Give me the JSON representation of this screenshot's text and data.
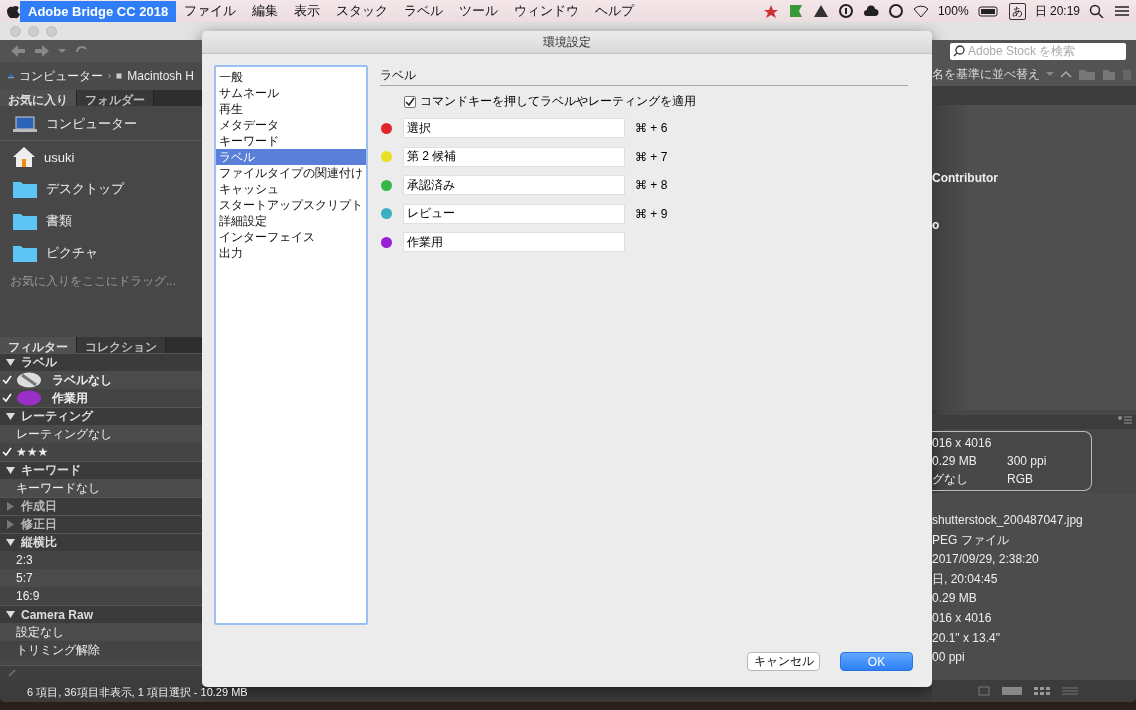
{
  "menu_bar": {
    "app_name": "Adobe Bridge CC 2018",
    "app_highlighted": true,
    "menus": [
      "ファイル",
      "編集",
      "表示",
      "スタック",
      "ラベル",
      "ツール",
      "ウィンドウ",
      "ヘルプ"
    ],
    "battery": "100%",
    "input_mode": "あ",
    "clock": "日 20:19"
  },
  "path_bar": {
    "items": [
      {
        "kind": "computer",
        "label": "コンピューター"
      },
      {
        "kind": "disk",
        "label": "Macintosh H"
      }
    ]
  },
  "panel_tabs": [
    {
      "label": "お気に入り",
      "selected": true
    },
    {
      "label": "フォルダー",
      "selected": false
    }
  ],
  "favorites": {
    "items": [
      {
        "kind": "computer",
        "label": "コンピューター"
      },
      {
        "kind": "home",
        "label": "usuki"
      },
      {
        "kind": "folder",
        "label": "デスクトップ"
      },
      {
        "kind": "folder",
        "label": "書類"
      },
      {
        "kind": "folder",
        "label": "ピクチャ"
      }
    ],
    "hint": "お気に入りをここにドラッグ..."
  },
  "filter_tabs": [
    {
      "label": "フィルター",
      "selected": true
    },
    {
      "label": "コレクション",
      "selected": false
    }
  ],
  "filters": [
    {
      "label": "ラベル",
      "expanded": true,
      "children": [
        {
          "label": "ラベルなし",
          "checked": true,
          "kind": "none"
        },
        {
          "label": "作業用",
          "checked": true,
          "kind": "swatch",
          "color": "#9a2fc8"
        }
      ]
    },
    {
      "label": "レーティング",
      "expanded": true,
      "children": [
        {
          "label": "レーティングなし",
          "checked": false,
          "kind": "text"
        },
        {
          "label": "★★★",
          "checked": true,
          "kind": "text"
        }
      ]
    },
    {
      "label": "キーワード",
      "expanded": true,
      "children": [
        {
          "label": "キーワードなし",
          "checked": false,
          "kind": "text"
        }
      ]
    },
    {
      "label": "作成日",
      "expanded": false
    },
    {
      "label": "修正日",
      "expanded": false
    },
    {
      "label": "縦横比",
      "expanded": true,
      "children": [
        {
          "label": "2:3",
          "checked": false,
          "kind": "text"
        },
        {
          "label": "5:7",
          "checked": false,
          "kind": "text"
        },
        {
          "label": "16:9",
          "checked": false,
          "kind": "text"
        }
      ]
    },
    {
      "label": "Camera Raw",
      "expanded": true,
      "children": [
        {
          "label": "設定なし",
          "checked": false,
          "kind": "text"
        },
        {
          "label": "トリミング解除",
          "checked": false,
          "kind": "text"
        }
      ]
    }
  ],
  "status_bar": "6 項目, 36項目非表示, 1 項目選択 - 10.29 MB",
  "search": {
    "placeholder": "Adobe Stock を検索"
  },
  "sort": {
    "label": "名を基準に並べ替え"
  },
  "content_texts": [
    "Contributor",
    "o"
  ],
  "metadata_summary": [
    [
      "016 x 4016"
    ],
    [
      "0.29 MB",
      "300 ppi"
    ],
    [
      "グなし",
      "RGB"
    ]
  ],
  "metadata_values": [
    "shutterstock_200487047.jpg",
    "PEG ファイル",
    "2017/09/29, 2:38:20",
    "日, 20:04:45",
    "0.29 MB",
    "016 x 4016",
    "20.1\" x 13.4\"",
    "00 ppi"
  ],
  "dialog": {
    "title": "環境設定",
    "categories": [
      {
        "label": "一般",
        "selected": false
      },
      {
        "label": "サムネール",
        "selected": false
      },
      {
        "label": "再生",
        "selected": false
      },
      {
        "label": "メタデータ",
        "selected": false
      },
      {
        "label": "キーワード",
        "selected": false
      },
      {
        "label": "ラベル",
        "selected": true
      },
      {
        "label": "ファイルタイプの関連付け",
        "selected": false
      },
      {
        "label": "キャッシュ",
        "selected": false
      },
      {
        "label": "スタートアップスクリプト",
        "selected": false
      },
      {
        "label": "詳細設定",
        "selected": false
      },
      {
        "label": "インターフェイス",
        "selected": false
      },
      {
        "label": "出力",
        "selected": false
      }
    ],
    "section_title": "ラベル",
    "option": {
      "label": "コマンドキーを押してラベルやレーティングを適用",
      "checked": true
    },
    "labels": [
      {
        "color": "#e0262a",
        "name": "選択",
        "shortcut": "⌘ + 6"
      },
      {
        "color": "#e8e021",
        "name": "第 2 候補",
        "shortcut": "⌘ + 7"
      },
      {
        "color": "#35b84a",
        "name": "承認済み",
        "shortcut": "⌘ + 8"
      },
      {
        "color": "#3aafc0",
        "name": "レビュー",
        "shortcut": "⌘ + 9"
      },
      {
        "color": "#9a1fd6",
        "name": "作業用"
      }
    ],
    "buttons": [
      {
        "label": "キャンセル",
        "kind": "cancel"
      },
      {
        "label": "OK",
        "kind": "default"
      }
    ]
  }
}
